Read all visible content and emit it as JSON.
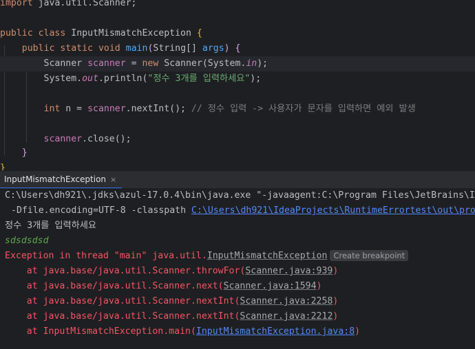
{
  "editor": {
    "line_import": {
      "keyword": "import",
      "rest": " java.util.Scanner;"
    },
    "line_class": {
      "kw1": "public",
      "kw2": "class",
      "name": "InputMismatchException",
      "brace": "{"
    },
    "line_main": {
      "kw1": "public",
      "kw2": "static",
      "kw3": "void",
      "name": "main",
      "open": "(",
      "type": "String[]",
      "param": "args",
      "close": ")",
      "brace": "{"
    },
    "line_scanner": {
      "type": "Scanner",
      "var": "scanner",
      "eq": " = ",
      "kw": "new",
      "ctor": " Scanner(System.",
      "field": "in",
      "end": ");"
    },
    "line_print": {
      "pre": "System.",
      "field": "out",
      "dot": ".println(",
      "str": "\"정수 3개를 입력하세요\"",
      "end": ");"
    },
    "line_int": {
      "kw": "int",
      "rest": " n = ",
      "var": "scanner",
      "call": ".nextInt();",
      "comment": " // 정수 입력 -> 사용자가 문자를 입력하면 예외 발생"
    },
    "line_close": {
      "var": "scanner",
      "call": ".close();"
    },
    "line_brace1": "}",
    "line_brace2": "}"
  },
  "run_tab": {
    "label": "InputMismatchException",
    "close": "×"
  },
  "console": {
    "cmd1": "C:\\Users\\dh921\\.jdks\\azul-17.0.4\\bin\\java.exe \"-javaagent:C:\\Program Files\\JetBrains\\I",
    "cmd2_pre": "-Dfile.encoding=UTF-8 -classpath ",
    "cmd2_link": "C:\\Users\\dh921\\IdeaProjects\\RuntimeErrortest\\out\\pro",
    "out1": "정수 3개를 입력하세요",
    "in1": "sdsdsdsd",
    "exc_pre": "Exception in thread \"main\" java.util.",
    "exc_link": "InputMismatchException",
    "exc_chip": "Create breakpoint",
    "stack": [
      {
        "pre": "    at java.base/java.util.Scanner.throwFor(",
        "link": "Scanner.java:939",
        "end": ")"
      },
      {
        "pre": "    at java.base/java.util.Scanner.next(",
        "link": "Scanner.java:1594",
        "end": ")"
      },
      {
        "pre": "    at java.base/java.util.Scanner.nextInt(",
        "link": "Scanner.java:2258",
        "end": ")"
      },
      {
        "pre": "    at java.base/java.util.Scanner.nextInt(",
        "link": "Scanner.java:2212",
        "end": ")"
      },
      {
        "pre": "    at InputMismatchException.main(",
        "link": "InputMismatchException.java:8",
        "end": ")"
      }
    ]
  },
  "colors": {
    "background": "#1e1f22",
    "keyword": "#cf8e6d",
    "function": "#56a8f5",
    "string": "#6aab73",
    "error": "#f75464",
    "link": "#548af7"
  }
}
